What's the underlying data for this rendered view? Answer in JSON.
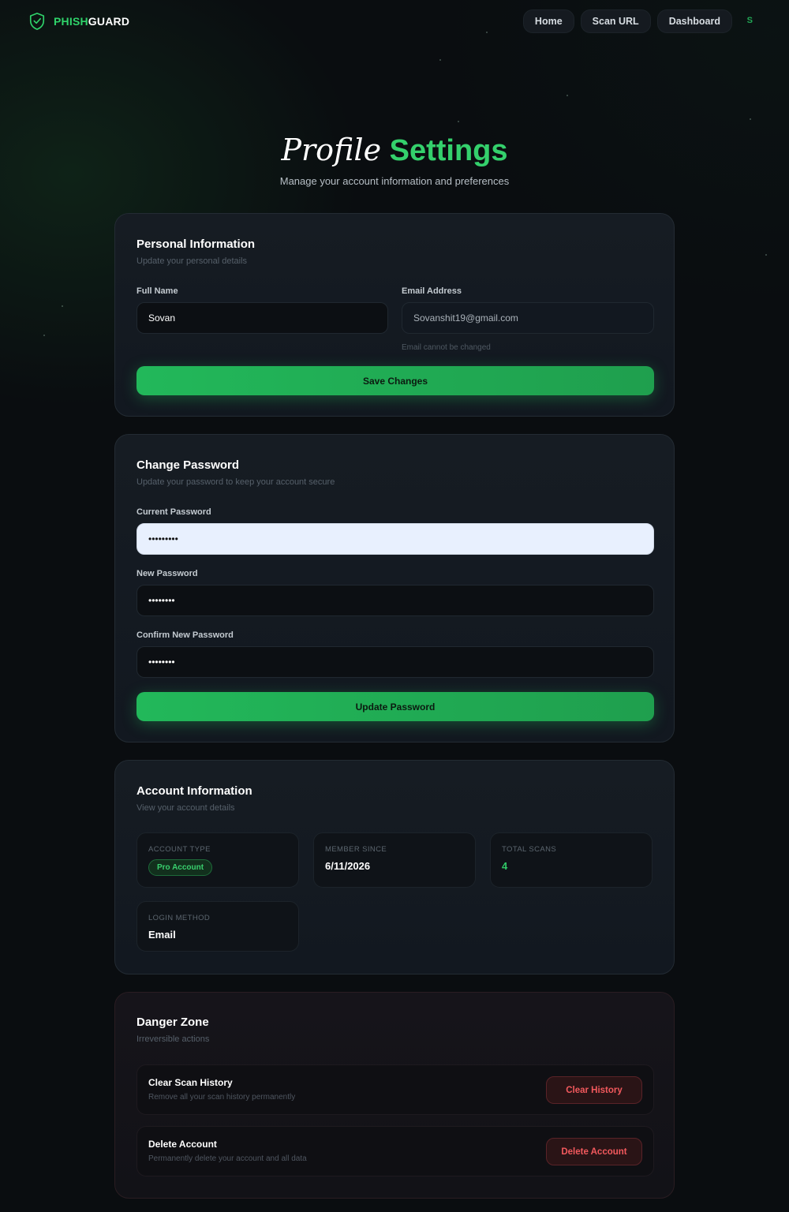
{
  "nav": {
    "logo_part1": "PHISH",
    "logo_part2": "GUARD",
    "links": [
      "Home",
      "Scan URL",
      "Dashboard"
    ],
    "avatar_initial": "S"
  },
  "header": {
    "title_part1": "Profile",
    "title_part2": "Settings",
    "subtitle": "Manage your account information and preferences"
  },
  "personal": {
    "title": "Personal Information",
    "subtitle": "Update your personal details",
    "full_name_label": "Full Name",
    "full_name_value": "Sovan",
    "email_label": "Email Address",
    "email_value": "Sovanshit19@gmail.com",
    "email_hint": "Email cannot be changed",
    "save_label": "Save Changes"
  },
  "password": {
    "title": "Change Password",
    "subtitle": "Update your password to keep your account secure",
    "current_label": "Current Password",
    "current_value": "•••••••••",
    "new_label": "New Password",
    "new_value": "••••••••",
    "confirm_label": "Confirm New Password",
    "confirm_value": "••••••••",
    "update_label": "Update Password"
  },
  "account": {
    "title": "Account Information",
    "subtitle": "View your account details",
    "type_label": "ACCOUNT TYPE",
    "type_value": "Pro Account",
    "member_label": "MEMBER SINCE",
    "member_value": "6/11/2026",
    "scans_label": "TOTAL SCANS",
    "scans_value": "4",
    "login_label": "LOGIN METHOD",
    "login_value": "Email"
  },
  "danger": {
    "title": "Danger Zone",
    "subtitle": "Irreversible actions",
    "clear_title": "Clear Scan History",
    "clear_sub": "Remove all your scan history permanently",
    "clear_button": "Clear History",
    "delete_title": "Delete Account",
    "delete_sub": "Permanently delete your account and all data",
    "delete_button": "Delete Account"
  },
  "colors": {
    "accent": "#34d06c",
    "danger": "#f2595d",
    "background": "#0a0d10"
  }
}
